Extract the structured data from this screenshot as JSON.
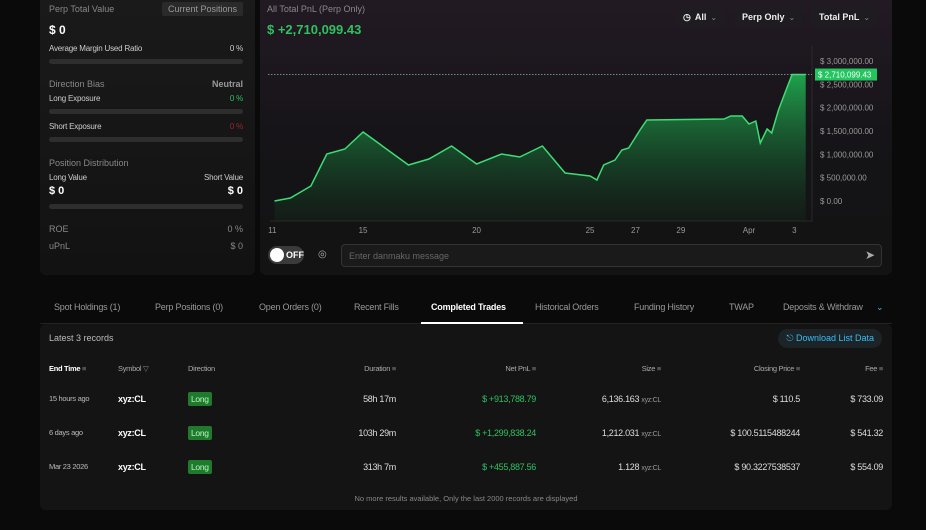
{
  "left_panel": {
    "perp_total_value_label": "Perp Total Value",
    "current_positions_button": "Current Positions",
    "perp_total_value": "$ 0",
    "avg_margin_label": "Average Margin Used Ratio",
    "avg_margin_value": "0 %",
    "avg_margin_fraction": 0,
    "direction_bias_label": "Direction Bias",
    "direction_bias_value": "Neutral",
    "long_exposure_label": "Long Exposure",
    "long_exposure_value": "0 %",
    "short_exposure_label": "Short Exposure",
    "short_exposure_value": "0 %",
    "position_distribution_label": "Position Distribution",
    "long_value_label": "Long Value",
    "short_value_label": "Short Value",
    "long_value": "$ 0",
    "short_value": "$ 0",
    "roe_label": "ROE",
    "roe_value": "0 %",
    "upnl_label": "uPnL",
    "upnl_value": "$ 0"
  },
  "chart_panel": {
    "title": "All Total PnL (Perp Only)",
    "total": "$ +2,710,099.43",
    "filters": {
      "time": "All",
      "scope": "Perp Only",
      "metric": "Total PnL"
    },
    "danmaku_toggle": "OFF",
    "danmaku_placeholder": "Enter danmaku message",
    "accent": "#22c55e"
  },
  "chart_data": {
    "type": "area",
    "x_unit": "day (Mar 11 = 11, Apr 1 = 32)",
    "points": [
      [
        11.1,
        0
      ],
      [
        11.8,
        64000
      ],
      [
        12.7,
        321000
      ],
      [
        13.4,
        1007000
      ],
      [
        14.2,
        1114000
      ],
      [
        15,
        1479000
      ],
      [
        17,
        771000
      ],
      [
        17.9,
        900000
      ],
      [
        18.9,
        1179000
      ],
      [
        20,
        793000
      ],
      [
        21.1,
        1007000
      ],
      [
        21.9,
        943000
      ],
      [
        22.9,
        1179000
      ],
      [
        23.9,
        600000
      ],
      [
        25,
        536000
      ],
      [
        25.3,
        450000
      ],
      [
        25.6,
        771000
      ],
      [
        26.1,
        879000
      ],
      [
        26.4,
        1093000
      ],
      [
        26.7,
        1136000
      ],
      [
        27.2,
        1521000
      ],
      [
        27.5,
        1736000
      ],
      [
        30.9,
        1757000
      ],
      [
        31.2,
        1821000
      ],
      [
        31.7,
        1821000
      ],
      [
        32,
        1650000
      ],
      [
        32.3,
        1714000
      ],
      [
        32.5,
        1243000
      ],
      [
        32.8,
        1543000
      ],
      [
        33,
        1457000
      ],
      [
        33.3,
        1950000
      ],
      [
        33.6,
        2336000
      ],
      [
        33.9,
        2710099.43
      ],
      [
        34.5,
        2710099.43
      ]
    ],
    "x_ticks": [
      {
        "label": "11",
        "x": 11
      },
      {
        "label": "15",
        "x": 15
      },
      {
        "label": "20",
        "x": 20
      },
      {
        "label": "25",
        "x": 25
      },
      {
        "label": "27",
        "x": 27
      },
      {
        "label": "29",
        "x": 29
      },
      {
        "label": "Apr",
        "x": 32
      },
      {
        "label": "3",
        "x": 34
      }
    ],
    "y_ticks": [
      "$ 0.00",
      "$ 500,000.00",
      "$ 1,000,000.00",
      "$ 1,500,000.00",
      "$ 2,000,000.00",
      "$ 2,500,000.00",
      "$ 3,000,000.00"
    ],
    "ylim": [
      0,
      3000000
    ],
    "xlim": [
      10.9,
      34.6
    ],
    "last_value_label": "$ 2,710,099.43",
    "last_value": 2710099.43,
    "grid": false
  },
  "tabs": [
    "Spot Holdings (1)",
    "Perp Positions (0)",
    "Open Orders (0)",
    "Recent Fills",
    "Completed Trades",
    "Historical Orders",
    "Funding History",
    "TWAP",
    "Deposits & Withdraw"
  ],
  "active_tab": "Completed Trades",
  "table": {
    "records_label": "Latest 3 records",
    "download_label": "Download List Data",
    "headers": [
      "End Time",
      "Symbol",
      "Direction",
      "Duration",
      "Net PnL",
      "Size",
      "Closing Price",
      "Fee"
    ],
    "rows": [
      {
        "end_time": "15 hours ago",
        "symbol": "xyz:CL",
        "direction": "Long",
        "duration": "58h 17m",
        "net_pnl": "$ +913,788.79",
        "size": "6,136.163",
        "size_unit": "xyz:CL",
        "closing_price": "$ 110.5",
        "fee": "$ 733.09"
      },
      {
        "end_time": "6 days ago",
        "symbol": "xyz:CL",
        "direction": "Long",
        "duration": "103h 29m",
        "net_pnl": "$ +1,299,838.24",
        "size": "1,212.031",
        "size_unit": "xyz:CL",
        "closing_price": "$ 100.5115488244",
        "fee": "$ 541.32"
      },
      {
        "end_time": "Mar 23 2026",
        "symbol": "xyz:CL",
        "direction": "Long",
        "duration": "313h 7m",
        "net_pnl": "$ +455,887.56",
        "size": "1.128",
        "size_unit": "xyz:CL",
        "closing_price": "$ 90.3227538537",
        "fee": "$ 554.09"
      }
    ],
    "footer": "No more results available, Only the last 2000 records are displayed"
  }
}
